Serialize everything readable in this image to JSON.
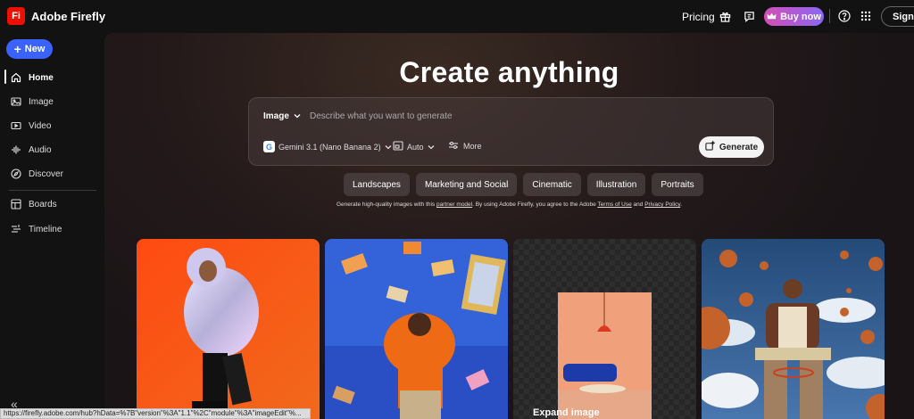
{
  "header": {
    "logo_text": "Fi",
    "app_title": "Adobe Firefly",
    "pricing": "Pricing",
    "buy_now": "Buy now",
    "sign_in": "Sign in"
  },
  "sidebar": {
    "new_label": "New",
    "items": [
      {
        "label": "Home",
        "icon": "home-icon"
      },
      {
        "label": "Image",
        "icon": "image-icon"
      },
      {
        "label": "Video",
        "icon": "video-icon"
      },
      {
        "label": "Audio",
        "icon": "audio-icon"
      },
      {
        "label": "Discover",
        "icon": "compass-icon"
      },
      {
        "label": "Boards",
        "icon": "boards-icon"
      },
      {
        "label": "Timeline",
        "icon": "timeline-icon"
      }
    ],
    "collapse_symbol": "«"
  },
  "main": {
    "headline": "Create anything",
    "prompt": {
      "mode": "Image",
      "placeholder": "Describe what you want to generate",
      "model": "Gemini 3.1 (Nano Banana 2)",
      "ratio": "Auto",
      "more": "More",
      "generate": "Generate"
    },
    "chips": [
      "Landscapes",
      "Marketing and Social",
      "Cinematic",
      "Illustration",
      "Portraits"
    ],
    "terms": {
      "prefix": "Generate high-quality images with this ",
      "partner_link": "partner model",
      "middle": ". By using Adobe Firefly, you agree to the Adobe ",
      "terms_link": "Terms of Use",
      "and": " and ",
      "privacy_link": "Privacy Policy",
      "suffix": "."
    },
    "cards": [
      {
        "label": ""
      },
      {
        "label": ""
      },
      {
        "label": "Expand image"
      },
      {
        "label": ""
      }
    ]
  },
  "status_url": "https://firefly.adobe.com/hub?hData=%7B\"version\"%3A\"1.1\"%2C\"module\"%3A\"imageEdit\"%...",
  "colors": {
    "accent_blue": "#3b63fb",
    "brand_red": "#eb1000",
    "buy_gradient_start": "#d44fb6",
    "buy_gradient_end": "#8a68f2"
  }
}
